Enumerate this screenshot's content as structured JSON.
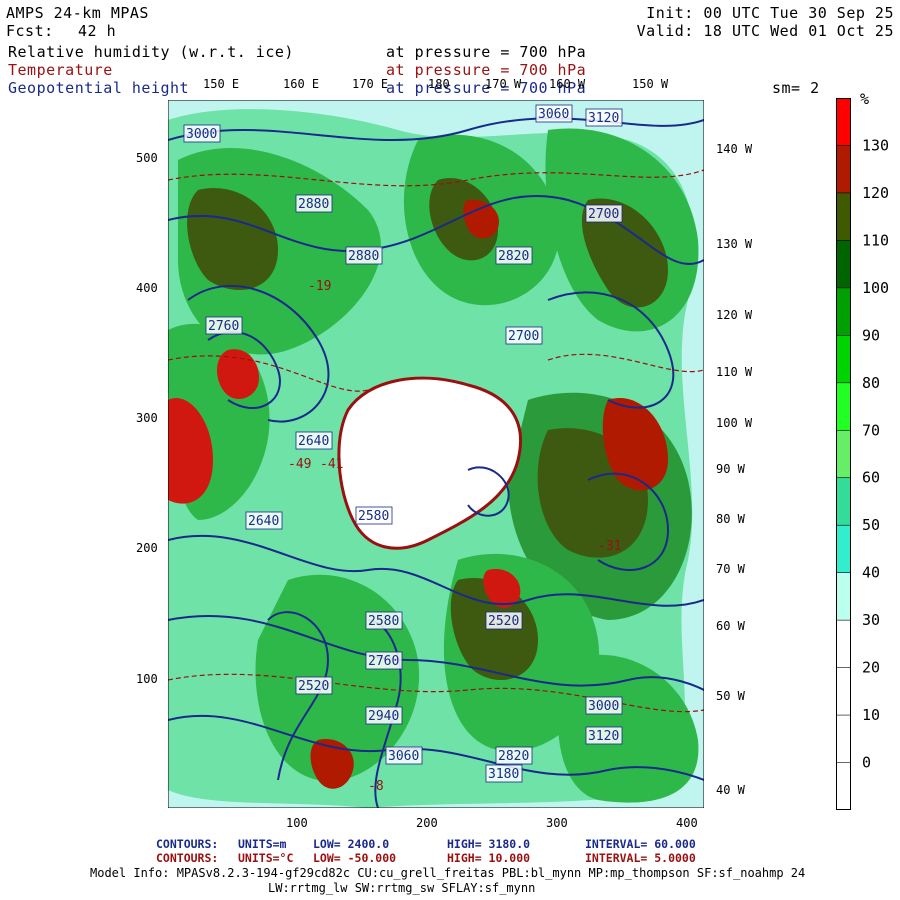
{
  "header": {
    "model": "AMPS 24-km MPAS",
    "fcst_label": "Fcst:",
    "fcst_value": "42 h",
    "init": "Init: 00 UTC Tue 30 Sep 25",
    "valid": "Valid: 18 UTC Wed 01 Oct 25"
  },
  "fields": [
    {
      "name": "Relative humidity (w.r.t. ice)",
      "level": "at pressure =  700 hPa",
      "color": "#000000"
    },
    {
      "name": "Temperature",
      "level": "at pressure =  700 hPa",
      "color": "#9a1010"
    },
    {
      "name": "Geopotential height",
      "level": "at pressure =  700 hPa",
      "color": "#1a2a8a"
    }
  ],
  "smoothing": "sm= 2",
  "top_lon_labels": [
    "150 E",
    "160 E",
    "170 E",
    "180",
    "170 W",
    "160 W",
    "150 W"
  ],
  "right_lon_labels": [
    "140 W",
    "130 W",
    "120 W",
    "110 W",
    "100 W",
    "90 W",
    "80 W",
    "70 W",
    "60 W",
    "50 W",
    "40 W"
  ],
  "y_ticks": [
    "500",
    "400",
    "300",
    "200",
    "100"
  ],
  "x_ticks": [
    "100",
    "200",
    "300",
    "400"
  ],
  "colorbar": {
    "unit": "%",
    "labels": [
      "130",
      "120",
      "110",
      "100",
      "90",
      "80",
      "70",
      "60",
      "50",
      "40",
      "30",
      "20",
      "10",
      "0"
    ],
    "colors": [
      "#ff0000",
      "#b01a00",
      "#3f5a00",
      "#006400",
      "#00a000",
      "#00d400",
      "#22ff22",
      "#66ee66",
      "#33dd99",
      "#33eecc",
      "#bbffee",
      "#ffffff",
      "#ffffff",
      "#ffffff"
    ]
  },
  "height_labels": [
    "3000",
    "2880",
    "3060",
    "2820",
    "2760",
    "2700",
    "2640",
    "2580",
    "2940",
    "3120",
    "2520",
    "3180",
    "3000",
    "2880",
    "2820",
    "2760",
    "2700",
    "2640",
    "2580",
    "2520",
    "3060",
    "3120"
  ],
  "temp_labels": [
    "-49",
    "-41",
    "-19",
    "-8",
    "-31"
  ],
  "footer": {
    "line1": {
      "label": "CONTOURS:",
      "units": "UNITS=m",
      "low": "LOW=  2400.0",
      "high": "HIGH=  3180.0",
      "interval": "INTERVAL=   60.000"
    },
    "line2": {
      "label": "CONTOURS:",
      "units": "UNITS=°C",
      "low": "LOW= -50.000",
      "high": "HIGH=  10.000",
      "interval": "INTERVAL=   5.0000"
    },
    "info1": "Model Info: MPASv8.2.3-194-gf29cd82c CU:cu_grell_freitas PBL:bl_mynn MP:mp_thompson SF:sf_noahmp 24",
    "info2": "LW:rrtmg_lw SW:rrtmg_sw SFLAY:sf_mynn"
  }
}
